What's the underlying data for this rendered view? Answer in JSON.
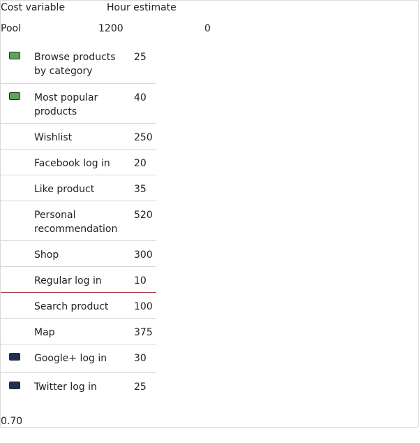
{
  "header": {
    "cost_variable_label": "Cost variable",
    "hour_estimate_label": "Hour estimate"
  },
  "pool": {
    "label": "Pool",
    "value": "1200",
    "extra": "0"
  },
  "colors": {
    "green": "#5fa35a",
    "navy": "#1f3054",
    "divider": "#a33a47"
  },
  "items": [
    {
      "name": "Browse products by category",
      "hours": "25",
      "swatch": "green"
    },
    {
      "name": "Most popular products",
      "hours": "40",
      "swatch": "green"
    },
    {
      "name": "Wishlist",
      "hours": "250",
      "swatch": ""
    },
    {
      "name": "Facebook log in",
      "hours": "20",
      "swatch": ""
    },
    {
      "name": "Like product",
      "hours": "35",
      "swatch": ""
    },
    {
      "name": "Personal recommendation",
      "hours": "520",
      "swatch": ""
    },
    {
      "name": "Shop",
      "hours": "300",
      "swatch": ""
    },
    {
      "name": "Regular log in",
      "hours": "10",
      "swatch": ""
    },
    {
      "name": "Search product",
      "hours": "100",
      "swatch": ""
    },
    {
      "name": "Map",
      "hours": "375",
      "swatch": ""
    },
    {
      "name": "Google+ log in",
      "hours": "30",
      "swatch": "navy"
    },
    {
      "name": "Twitter log in",
      "hours": "25",
      "swatch": "navy"
    }
  ],
  "footer": {
    "value": "0.70"
  }
}
